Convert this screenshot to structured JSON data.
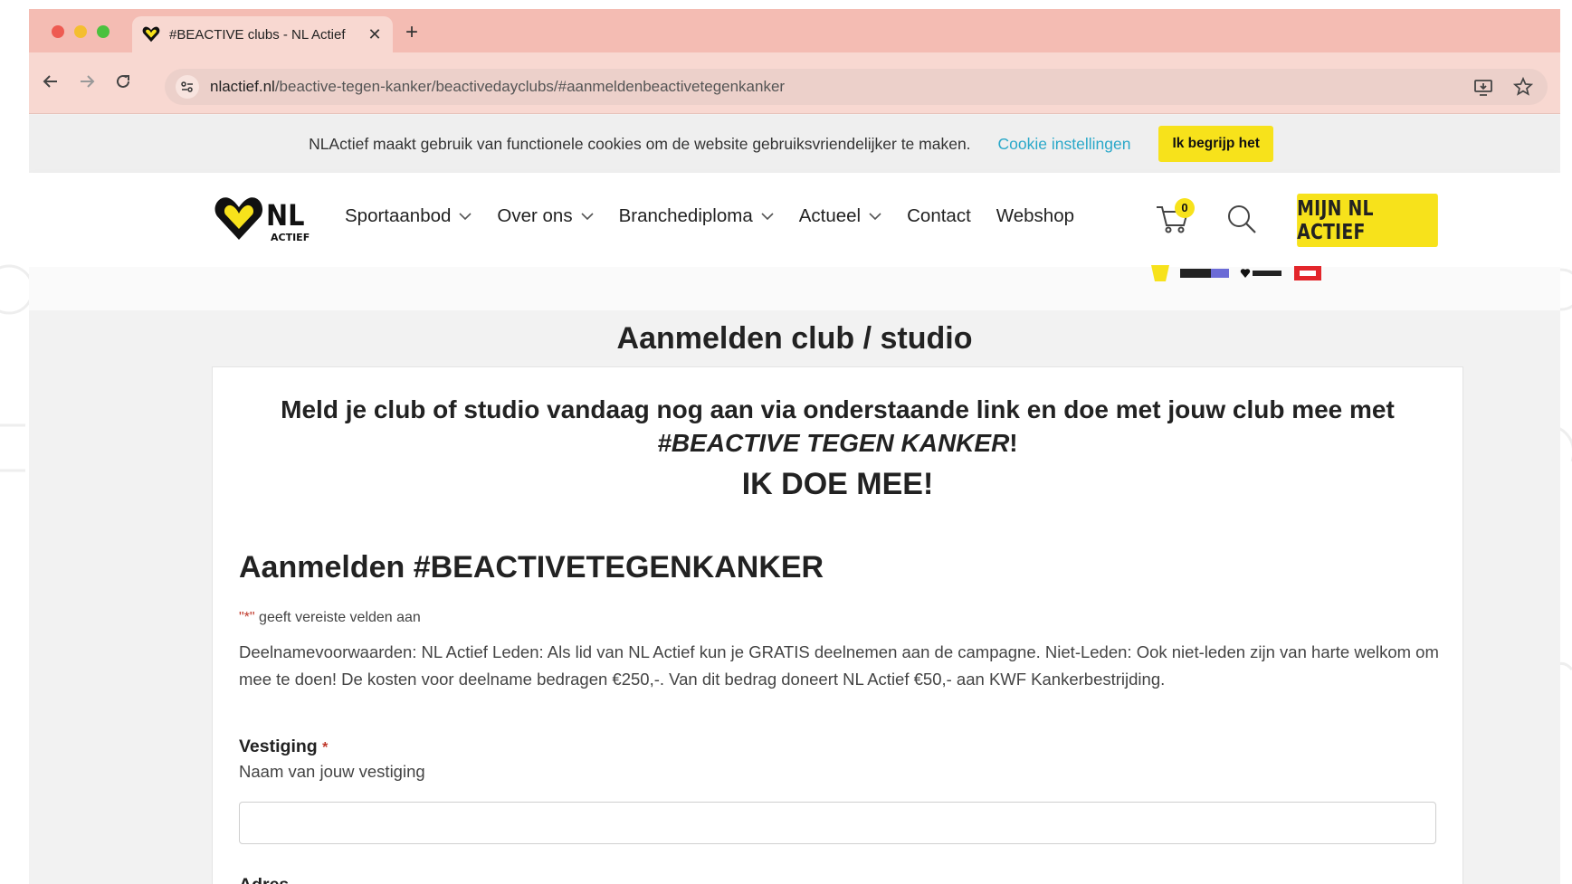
{
  "colors": {
    "tabbar": "#f4bcb3",
    "toolbar": "#f8d8d1",
    "brand_yellow": "#f7e21b",
    "cookie_link": "#2aa8c9",
    "required_star": "#c0392b"
  },
  "browser": {
    "tab": {
      "title": "#BEACTIVE clubs - NL Actief",
      "close": "✕",
      "favicon": "heart-logo-icon"
    },
    "new_tab": "+",
    "url": {
      "domain": "nlactief.nl",
      "path": "/beactive-tegen-kanker/beactivedayclubs/#aanmeldenbeactivetegenkanker"
    },
    "nav_icons": [
      "back-icon",
      "forward-icon",
      "reload-icon",
      "site-settings-icon",
      "install-icon",
      "bookmark-star-icon"
    ]
  },
  "cookie_bar": {
    "message": "NLActief maakt gebruik van functionele cookies om de website gebruiksvriendelijker te maken.",
    "settings_link": "Cookie instellingen",
    "accept_button": "Ik begrijp het"
  },
  "header": {
    "logo_text": "NL ACTIEF",
    "nav": [
      {
        "label": "Sportaanbod",
        "dropdown": true
      },
      {
        "label": "Over ons",
        "dropdown": true
      },
      {
        "label": "Branchediploma",
        "dropdown": true
      },
      {
        "label": "Actueel",
        "dropdown": true
      },
      {
        "label": "Contact",
        "dropdown": false
      },
      {
        "label": "Webshop",
        "dropdown": false
      }
    ],
    "cart_count": "0",
    "account_button": "MIJN NL ACTIEF"
  },
  "content": {
    "section_title": "Aanmelden club / studio",
    "intro_line1": "Meld je club of studio vandaag nog aan via onderstaande link en doe met jouw club mee met",
    "intro_campaign": "#BEACTIVE TEGEN KANKER",
    "intro_suffix": "!",
    "cta": "IK DOE MEE!",
    "form_title": "Aanmelden #BEACTIVETEGENKANKER",
    "required_note_star": "\"*\"",
    "required_note": " geeft vereiste velden aan",
    "conditions": "Deelnamevoorwaarden: NL Actief Leden: Als lid van NL Actief kun je GRATIS deelnemen aan de campagne. Niet-Leden: Ook niet-leden zijn van harte welkom om mee te doen! De kosten voor deelname bedragen €250,-. Van dit bedrag doneert NL Actief €50,- aan KWF Kankerbestrijding.",
    "fields": {
      "vestiging_label": "Vestiging",
      "required_mark": "*",
      "vestiging_sublabel": "Naam van jouw vestiging",
      "vestiging_value": "",
      "adres_label": "Adres"
    }
  }
}
